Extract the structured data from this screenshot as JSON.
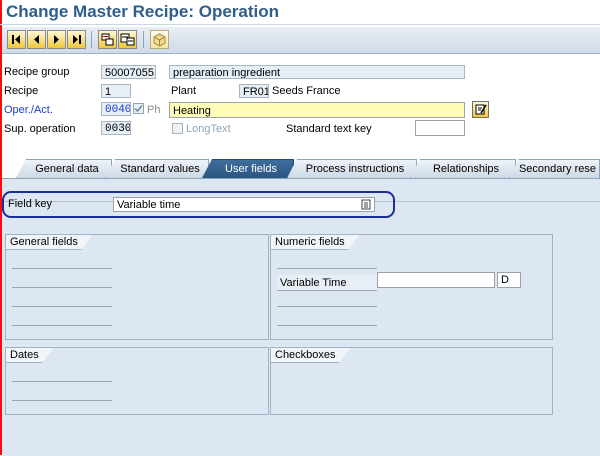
{
  "window": {
    "title": "Change Master Recipe: Operation"
  },
  "toolbar": {
    "buttons": [
      "first-icon",
      "previous-icon",
      "next-icon",
      "last-icon",
      "object-overview-icon",
      "components-icon",
      "package-icon"
    ]
  },
  "header": {
    "recipe_group_label": "Recipe group",
    "recipe_group_value": "50007055",
    "recipe_group_desc": "preparation ingredient",
    "recipe_label": "Recipe",
    "recipe_value": "1",
    "plant_label": "Plant",
    "plant_value": "FR01",
    "plant_desc": "Seeds France",
    "oper_label": "Oper./Act.",
    "oper_value": "0040",
    "ph_label": "Ph",
    "oper_desc": "Heating",
    "sup_label": "Sup. operation",
    "sup_value": "0030",
    "longtext_label": "LongText",
    "std_text_key_label": "Standard text key",
    "std_text_key_value": ""
  },
  "tabs": [
    {
      "label": "General data",
      "active": false
    },
    {
      "label": "Standard values",
      "active": false
    },
    {
      "label": "User fields",
      "active": true
    },
    {
      "label": "Process instructions",
      "active": false
    },
    {
      "label": "Relationships",
      "active": false
    },
    {
      "label": "Secondary rese",
      "active": false
    }
  ],
  "user_fields": {
    "field_key_label": "Field key",
    "field_key_value": "Variable time",
    "general_fields_title": "General fields",
    "numeric_fields_title": "Numeric fields",
    "variable_time_label": "Variable Time",
    "variable_time_value": "",
    "variable_time_unit": "D",
    "dates_title": "Dates",
    "checkboxes_title": "Checkboxes"
  },
  "colors": {
    "title": "#2f5d8c",
    "active_tab": "#2d5580",
    "panel": "#dde7f1",
    "highlight_border": "#1b2d9a",
    "required_field": "#fffcb8"
  }
}
